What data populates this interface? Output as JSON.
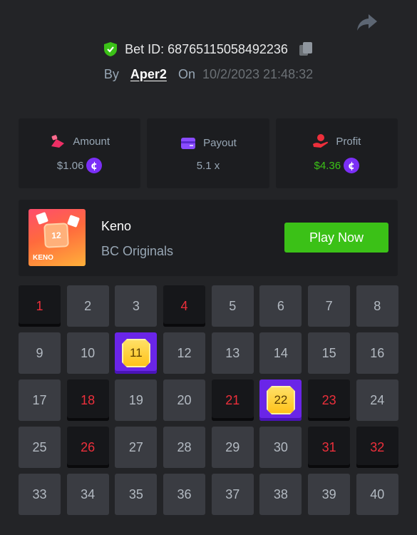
{
  "header": {
    "bet_id_label": "Bet ID: 68765115058492236",
    "by_label": "By",
    "user": "Aper2",
    "on_label": "On",
    "date": "10/2/2023 21:48:32"
  },
  "stats": {
    "amount": {
      "label": "Amount",
      "value": "$1.06"
    },
    "payout": {
      "label": "Payout",
      "value": "5.1 x"
    },
    "profit": {
      "label": "Profit",
      "value": "$4.36"
    }
  },
  "game": {
    "name": "Keno",
    "provider": "BC Originals",
    "thumb_number": "12",
    "thumb_label": "KENO",
    "play_label": "Play Now"
  },
  "grid": {
    "numbers": [
      "1",
      "2",
      "3",
      "4",
      "5",
      "6",
      "7",
      "8",
      "9",
      "10",
      "11",
      "12",
      "13",
      "14",
      "15",
      "16",
      "17",
      "18",
      "19",
      "20",
      "21",
      "22",
      "23",
      "24",
      "25",
      "26",
      "27",
      "28",
      "29",
      "30",
      "31",
      "32",
      "33",
      "34",
      "35",
      "36",
      "37",
      "38",
      "39",
      "40"
    ],
    "picked": [
      "1",
      "4",
      "18",
      "21",
      "23",
      "26",
      "31",
      "32"
    ],
    "hits": [
      "11",
      "22"
    ]
  },
  "icons": {
    "share": "share-arrow-icon",
    "verified": "shield-check-icon",
    "copy": "copy-icon",
    "amount": "bet-amount-icon",
    "payout": "card-icon",
    "profit": "profit-icon",
    "coin": "bcd-coin-icon"
  },
  "colors": {
    "green": "#3bc117",
    "red_number": "#ed2f3b",
    "purple_hit": "#6a25e8",
    "coin_purple": "#7b2ff7"
  }
}
